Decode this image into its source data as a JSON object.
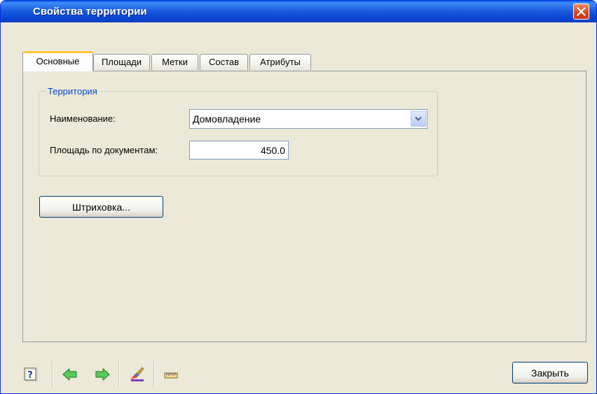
{
  "window": {
    "title": "Свойства территории"
  },
  "tabs": [
    {
      "label": "Основные",
      "active": true
    },
    {
      "label": "Площади",
      "active": false
    },
    {
      "label": "Метки",
      "active": false
    },
    {
      "label": "Состав",
      "active": false
    },
    {
      "label": "Атрибуты",
      "active": false
    }
  ],
  "territory_group": {
    "title": "Территория",
    "name_label": "Наименование:",
    "name_value": "Домовладение",
    "area_label": "Площадь по документам:",
    "area_value": "450.0"
  },
  "hatch_button": "Штриховка...",
  "toolbar": {
    "icons": [
      "help-icon",
      "arrow-back-icon",
      "arrow-forward-icon",
      "paint-brush-icon",
      "ruler-icon"
    ]
  },
  "close_button": "Закрыть",
  "colors": {
    "titlebar": "#0A4FD6",
    "face": "#ECE9D8",
    "group_title": "#0046D5",
    "tab_highlight": "#FFC83C",
    "arrow_green": "#4CB24C"
  }
}
